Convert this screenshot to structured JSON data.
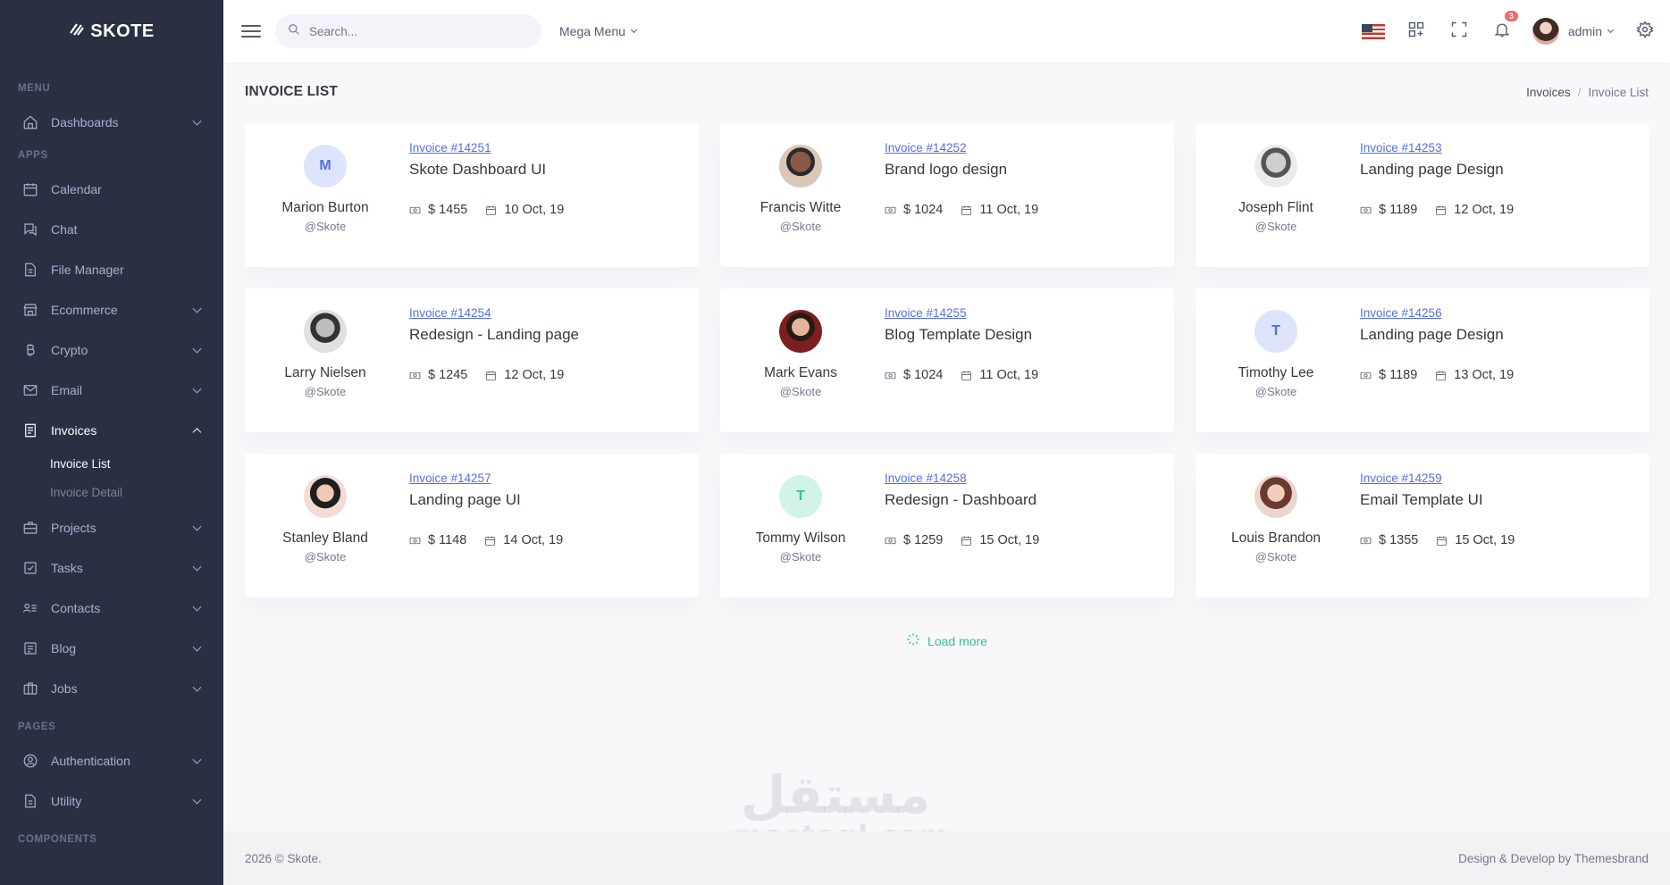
{
  "brand": {
    "name": "SKOTE"
  },
  "sidebar": {
    "titles": {
      "menu": "MENU",
      "apps": "APPS",
      "pages": "PAGES",
      "components": "COMPONENTS"
    },
    "items": [
      {
        "label": "Dashboards"
      },
      {
        "label": "Calendar"
      },
      {
        "label": "Chat"
      },
      {
        "label": "File Manager"
      },
      {
        "label": "Ecommerce"
      },
      {
        "label": "Crypto"
      },
      {
        "label": "Email"
      },
      {
        "label": "Invoices"
      },
      {
        "label": "Projects"
      },
      {
        "label": "Tasks"
      },
      {
        "label": "Contacts"
      },
      {
        "label": "Blog"
      },
      {
        "label": "Jobs"
      },
      {
        "label": "Authentication"
      },
      {
        "label": "Utility"
      }
    ],
    "invoice_sub": [
      {
        "label": "Invoice List"
      },
      {
        "label": "Invoice Detail"
      }
    ]
  },
  "topbar": {
    "search_placeholder": "Search...",
    "mega_menu": "Mega Menu",
    "notification_count": "3",
    "user": "admin"
  },
  "page": {
    "title": "INVOICE LIST",
    "breadcrumb": [
      "Invoices",
      "Invoice List"
    ]
  },
  "invoices": [
    {
      "name": "Marion Burton",
      "handle": "@Skote",
      "invoice": "Invoice #14251",
      "title": "Skote Dashboard UI",
      "amount": "$ 1455",
      "date": "10 Oct, 19",
      "initial": "M"
    },
    {
      "name": "Francis Witte",
      "handle": "@Skote",
      "invoice": "Invoice #14252",
      "title": "Brand logo design",
      "amount": "$ 1024",
      "date": "11 Oct, 19"
    },
    {
      "name": "Joseph Flint",
      "handle": "@Skote",
      "invoice": "Invoice #14253",
      "title": "Landing page Design",
      "amount": "$ 1189",
      "date": "12 Oct, 19"
    },
    {
      "name": "Larry Nielsen",
      "handle": "@Skote",
      "invoice": "Invoice #14254",
      "title": "Redesign - Landing page",
      "amount": "$ 1245",
      "date": "12 Oct, 19"
    },
    {
      "name": "Mark Evans",
      "handle": "@Skote",
      "invoice": "Invoice #14255",
      "title": "Blog Template Design",
      "amount": "$ 1024",
      "date": "11 Oct, 19"
    },
    {
      "name": "Timothy Lee",
      "handle": "@Skote",
      "invoice": "Invoice #14256",
      "title": "Landing page Design",
      "amount": "$ 1189",
      "date": "13 Oct, 19",
      "initial": "T"
    },
    {
      "name": "Stanley Bland",
      "handle": "@Skote",
      "invoice": "Invoice #14257",
      "title": "Landing page UI",
      "amount": "$ 1148",
      "date": "14 Oct, 19"
    },
    {
      "name": "Tommy Wilson",
      "handle": "@Skote",
      "invoice": "Invoice #14258",
      "title": "Redesign - Dashboard",
      "amount": "$ 1259",
      "date": "15 Oct, 19",
      "initial": "T"
    },
    {
      "name": "Louis Brandon",
      "handle": "@Skote",
      "invoice": "Invoice #14259",
      "title": "Email Template UI",
      "amount": "$ 1355",
      "date": "15 Oct, 19"
    }
  ],
  "load_more": "Load more",
  "footer": {
    "left": "2026 © Skote.",
    "right": "Design & Develop by Themesbrand"
  },
  "watermark": {
    "ar": "مستقل",
    "en": "mostaql.com"
  },
  "colors": {
    "sidebar": "#2a3042",
    "primary": "#556ee6",
    "success": "#34c38f",
    "danger": "#f46a6a"
  }
}
